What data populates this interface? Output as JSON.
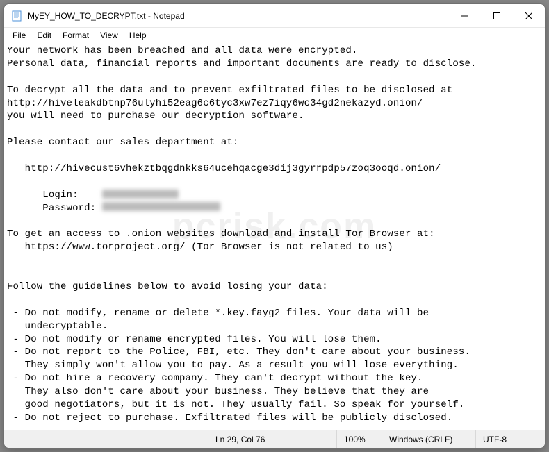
{
  "window": {
    "title": "MyEY_HOW_TO_DECRYPT.txt - Notepad"
  },
  "menubar": {
    "items": [
      "File",
      "Edit",
      "Format",
      "View",
      "Help"
    ]
  },
  "body": {
    "l1": "Your network has been breached and all data were encrypted.",
    "l2": "Personal data, financial reports and important documents are ready to disclose.",
    "l3": "",
    "l4": "To decrypt all the data and to prevent exfiltrated files to be disclosed at",
    "l5": "http://hiveleakdbtnp76ulyhi52eag6c6tyc3xw7ez7iqy6wc34gd2nekazyd.onion/",
    "l6": "you will need to purchase our decryption software.",
    "l7": "",
    "l8": "Please contact our sales department at:",
    "l9": "",
    "l10": "   http://hivecust6vhekztbqgdnkks64ucehqacge3dij3gyrrpdp57zoq3ooqd.onion/",
    "l11": "",
    "l12": "      Login:    ",
    "l13": "      Password: ",
    "l14": "",
    "l15": "To get an access to .onion websites download and install Tor Browser at:",
    "l16": "   https://www.torproject.org/ (Tor Browser is not related to us)",
    "l17": "",
    "l18": "",
    "l19": "Follow the guidelines below to avoid losing your data:",
    "l20": "",
    "l21": " - Do not modify, rename or delete *.key.fayg2 files. Your data will be",
    "l22": "   undecryptable.",
    "l23": " - Do not modify or rename encrypted files. You will lose them.",
    "l24": " - Do not report to the Police, FBI, etc. They don't care about your business.",
    "l25": "   They simply won't allow you to pay. As a result you will lose everything.",
    "l26": " - Do not hire a recovery company. They can't decrypt without the key.",
    "l27": "   They also don't care about your business. They believe that they are",
    "l28": "   good negotiators, but it is not. They usually fail. So speak for yourself.",
    "l29": " - Do not reject to purchase. Exfiltrated files will be publicly disclosed."
  },
  "status": {
    "position": "Ln 29, Col 76",
    "zoom": "100%",
    "lineending": "Windows (CRLF)",
    "encoding": "UTF-8"
  },
  "watermark": "pcrisk.com"
}
